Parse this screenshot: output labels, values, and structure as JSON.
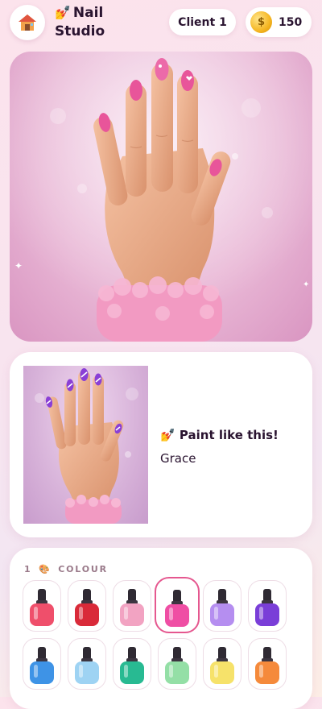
{
  "header": {
    "home_icon": "house-icon",
    "logo_line1": "Nail",
    "logo_line2": "Studio",
    "logo_icon": "nail-polish-brush-icon",
    "client_label": "Client 1",
    "coin_icon": "dollar-coin-icon",
    "coins": "150"
  },
  "scene": {
    "nail_color": "#e8559a",
    "background": "#e9b8d6",
    "cuff_color": "#f29ac2"
  },
  "reference": {
    "title": "Paint like this!",
    "title_icon": "nail-polish-brush-icon",
    "client_name": "Grace",
    "nail_color": "#8a3fd6",
    "stripe_color": "#ffffff"
  },
  "palette": {
    "step_number": "1",
    "step_icon": "palette-icon",
    "label": "COLOUR",
    "selected_index": 3,
    "colors": [
      {
        "hex": "#ef4f6b"
      },
      {
        "hex": "#d92a39"
      },
      {
        "hex": "#f2a3c2"
      },
      {
        "hex": "#ef4ea4"
      },
      {
        "hex": "#b58ef0"
      },
      {
        "hex": "#7a3ed8"
      },
      {
        "hex": "#3e93e6"
      },
      {
        "hex": "#9ed3f3"
      },
      {
        "hex": "#28ba92"
      },
      {
        "hex": "#94dfa6"
      },
      {
        "hex": "#f6e26a"
      },
      {
        "hex": "#f58a3b"
      }
    ]
  }
}
